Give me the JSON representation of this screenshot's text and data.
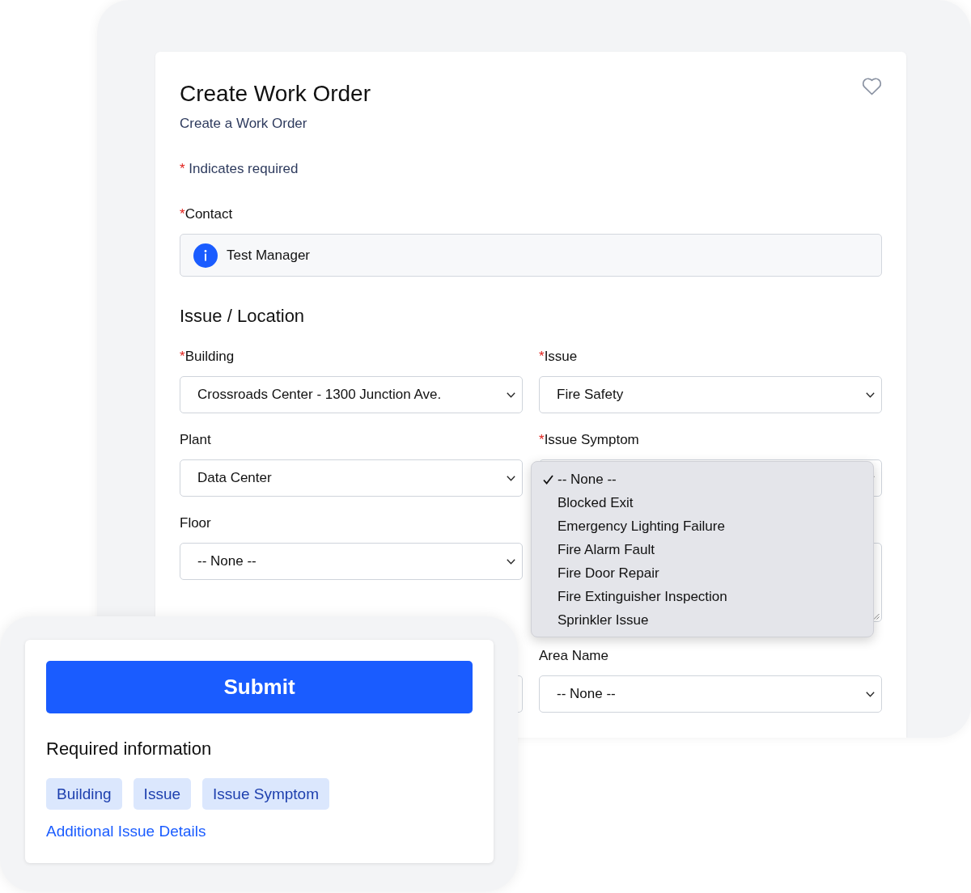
{
  "form_card": {
    "title": "Create Work Order",
    "subtitle": "Create a Work Order",
    "required_note": {
      "mark": "*",
      "text": "Indicates required"
    },
    "contact": {
      "mark": "*",
      "label": "Contact",
      "value": "Test Manager"
    },
    "section_title": "Issue / Location",
    "fields": [
      {
        "kind": "select",
        "mark": "*",
        "label": "Building",
        "value": "Crossroads Center - 1300 Junction Ave."
      },
      {
        "kind": "select",
        "mark": "*",
        "label": "Issue",
        "value": "Fire Safety"
      },
      {
        "kind": "select",
        "label": "Plant",
        "value": "Data Center"
      },
      {
        "kind": "select",
        "mark": "*",
        "label": "Issue Symptom",
        "open": true,
        "options": [
          {
            "label": "-- None --",
            "selected": true
          },
          {
            "label": "Blocked Exit",
            "selected": false
          },
          {
            "label": "Emergency Lighting Failure",
            "selected": false
          },
          {
            "label": "Fire Alarm Fault",
            "selected": false
          },
          {
            "label": "Fire Door Repair",
            "selected": false
          },
          {
            "label": "Fire Extinguisher Inspection",
            "selected": false
          },
          {
            "label": "Sprinkler Issue",
            "selected": false
          }
        ]
      },
      {
        "kind": "select",
        "label": "Floor",
        "value": "-- None --"
      },
      {
        "kind": "textarea"
      },
      {
        "kind": "sliver"
      },
      {
        "kind": "select",
        "label": "Area Name",
        "value": "-- None --"
      }
    ]
  },
  "summary_card": {
    "button": "Submit",
    "heading": "Required information",
    "tags": [
      "Building",
      "Issue",
      "Issue Symptom"
    ],
    "link": "Additional Issue Details"
  }
}
